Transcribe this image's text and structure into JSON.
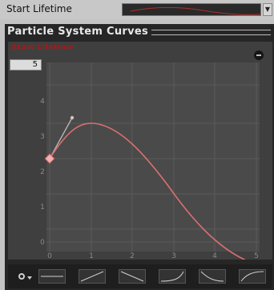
{
  "property": {
    "label": "Start Lifetime"
  },
  "panel": {
    "title": "Particle System Curves"
  },
  "editor": {
    "curve_label": "Start Lifetime",
    "value": "5",
    "y_ticks": [
      "0",
      "1",
      "2",
      "3",
      "4"
    ],
    "x_ticks": [
      "0",
      "1",
      "2",
      "3",
      "4",
      "5"
    ],
    "curve_color": "#d96f6f",
    "background_color": "#3f3f3f"
  },
  "presets": {
    "items": [
      "flat",
      "linear-up",
      "linear-down",
      "ease-in",
      "ease-out-down",
      "ease-out-up"
    ]
  }
}
